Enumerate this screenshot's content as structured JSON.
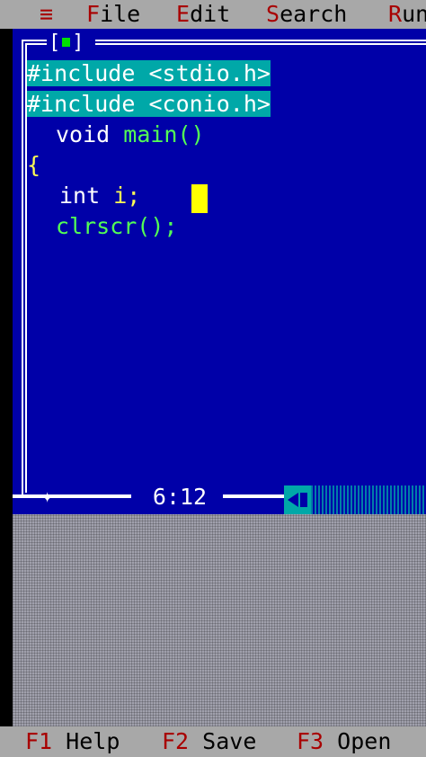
{
  "menu": {
    "system": "≡",
    "items": [
      {
        "hot": "F",
        "rest": "ile"
      },
      {
        "hot": "E",
        "rest": "dit"
      },
      {
        "hot": "S",
        "rest": "earch"
      },
      {
        "hot": "R",
        "rest": "un"
      }
    ]
  },
  "editor": {
    "close_box": "[■]",
    "lines": {
      "l1": "#include <stdio.h>",
      "l2": "#include <conio.h>",
      "l3_kw": "void",
      "l3_fn": "main()",
      "l4": "{",
      "l5_kw": "int",
      "l5_rest": "i;",
      "l6": "clrscr();"
    },
    "cursor_position": "6:12"
  },
  "statusbar": {
    "items": [
      {
        "key": "F1",
        "label": "Help"
      },
      {
        "key": "F2",
        "label": "Save"
      },
      {
        "key": "F3",
        "label": "Open"
      }
    ]
  },
  "colors": {
    "editor_bg": "#0000a8",
    "selection": "#00a8a8",
    "menu_bg": "#a8a8a8",
    "hotkey": "#a80000"
  }
}
